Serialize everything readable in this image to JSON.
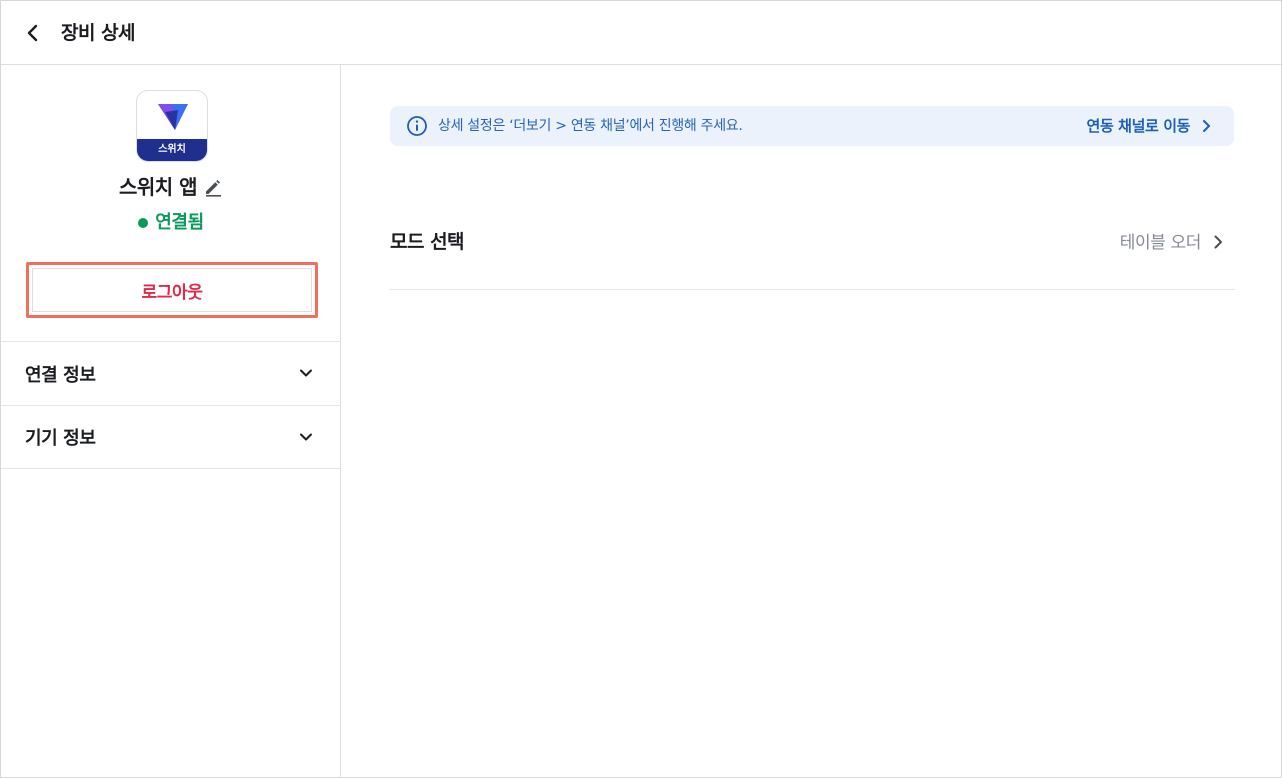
{
  "header": {
    "title": "장비 상세",
    "back_icon": "chevron-left-icon"
  },
  "device": {
    "icon_label": "스위치",
    "name": "스위치 앱",
    "status": "연결됨",
    "status_color": "#0a9a5c",
    "brand_color": "#1f2f8f"
  },
  "actions": {
    "logout_label": "로그아웃",
    "logout_color": "#e0294a"
  },
  "sections": [
    {
      "label": "연결 정보"
    },
    {
      "label": "기기 정보"
    }
  ],
  "notice": {
    "text": "상세 설정은 ‘더보기 > 연동 채널’에서 진행해 주세요.",
    "link_label": "연동 채널로 이동",
    "accent": "#1d5fb5"
  },
  "mode": {
    "label": "모드 선택",
    "value": "테이블 오더"
  }
}
